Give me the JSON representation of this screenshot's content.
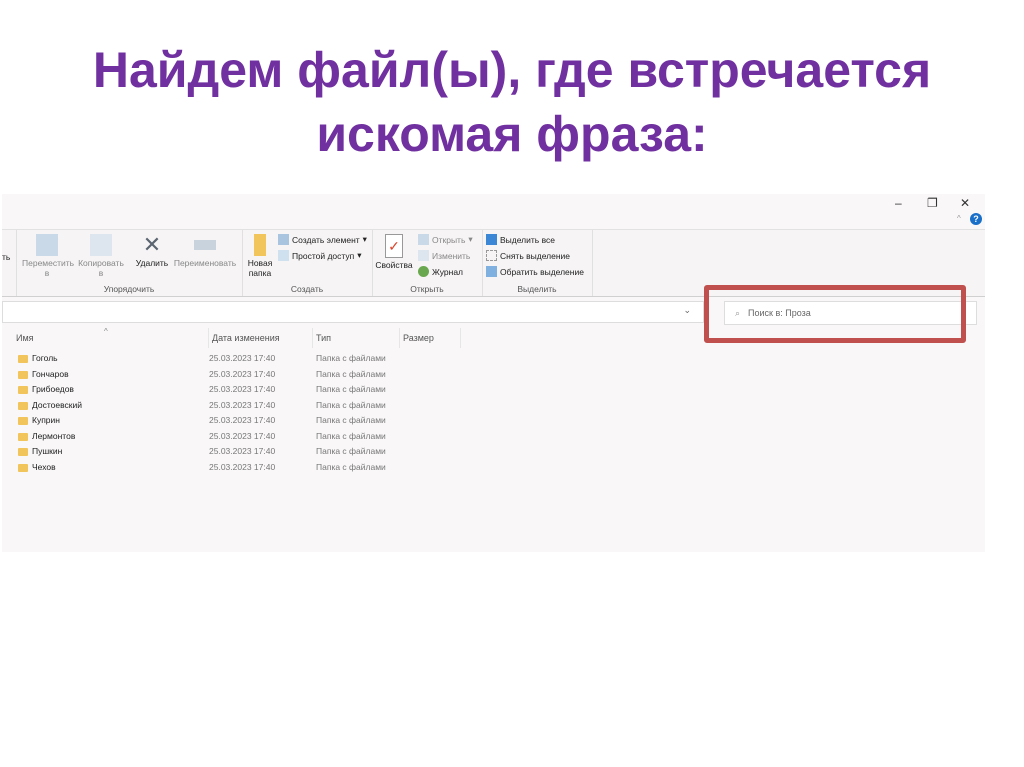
{
  "slide": {
    "title_line1": "Найдем файл(ы), где встречается",
    "title_line2": "искомая фраза:"
  },
  "window": {
    "minimize": "–",
    "maximize": "❐",
    "close": "✕",
    "help": "?",
    "collapse": "^"
  },
  "ribbon": {
    "partial_left": "ть",
    "groups": [
      {
        "label": "Упорядочить",
        "items": [
          "Переместить в",
          "Копировать в",
          "Удалить",
          "Переименовать"
        ]
      },
      {
        "label": "Создать",
        "items": [
          "Новая папка",
          "Создать элемент",
          "Простой доступ"
        ]
      },
      {
        "label": "Открыть",
        "items": [
          "Свойства",
          "Открыть",
          "Изменить",
          "Журнал"
        ]
      },
      {
        "label": "Выделить",
        "items": [
          "Выделить все",
          "Снять выделение",
          "Обратить выделение"
        ]
      }
    ]
  },
  "search": {
    "placeholder": "Поиск в: Проза"
  },
  "columns": [
    "Имя",
    "Дата изменения",
    "Тип",
    "Размер"
  ],
  "files": [
    {
      "name": "Гоголь",
      "date": "25.03.2023 17:40",
      "type": "Папка с файлами"
    },
    {
      "name": "Гончаров",
      "date": "25.03.2023 17:40",
      "type": "Папка с файлами"
    },
    {
      "name": "Грибоедов",
      "date": "25.03.2023 17:40",
      "type": "Папка с файлами"
    },
    {
      "name": "Достоевский",
      "date": "25.03.2023 17:40",
      "type": "Папка с файлами"
    },
    {
      "name": "Куприн",
      "date": "25.03.2023 17:40",
      "type": "Папка с файлами"
    },
    {
      "name": "Лермонтов",
      "date": "25.03.2023 17:40",
      "type": "Папка с файлами"
    },
    {
      "name": "Пушкин",
      "date": "25.03.2023 17:40",
      "type": "Папка с файлами"
    },
    {
      "name": "Чехов",
      "date": "25.03.2023 17:40",
      "type": "Папка с файлами"
    }
  ],
  "colors": {
    "title": "#7030a0",
    "highlight": "#c0504d"
  }
}
